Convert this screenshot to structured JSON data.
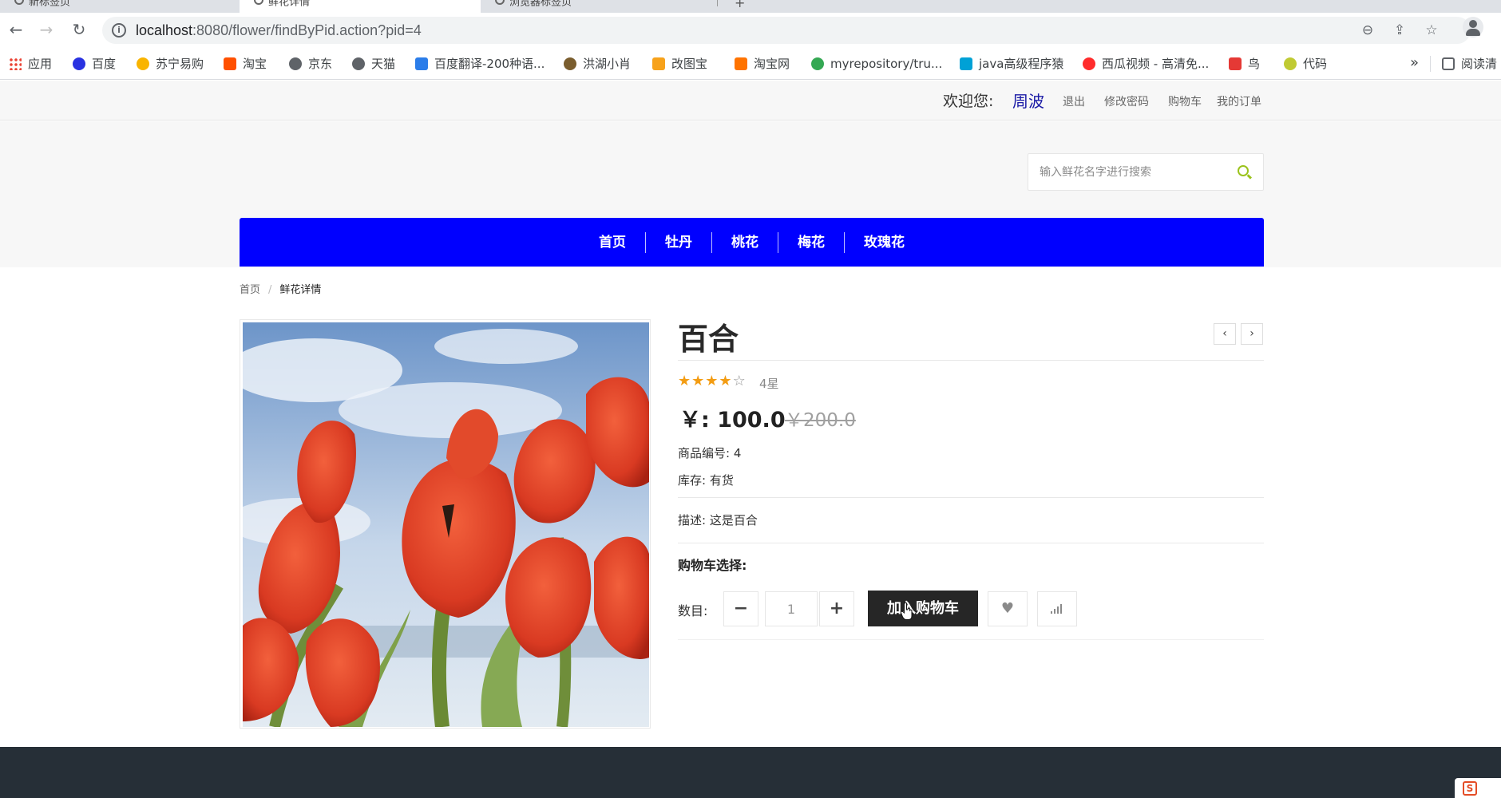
{
  "browser": {
    "tabs": [
      {
        "title": "新标签页"
      },
      {
        "title": "鲜花详情"
      },
      {
        "title": "浏览器标签页"
      }
    ],
    "url_host": "localhost",
    "url_rest": ":8080/flower/findByPid.action?pid=4",
    "bookmarks": [
      {
        "label": "应用",
        "icon": "apps-icon",
        "color": "#ea4335"
      },
      {
        "label": "百度",
        "icon": "baidu-icon",
        "color": "#2932e1"
      },
      {
        "label": "苏宁易购",
        "icon": "suning-icon",
        "color": "#f9b400"
      },
      {
        "label": "淘宝",
        "icon": "taobao-icon",
        "color": "#ff5000"
      },
      {
        "label": "京东",
        "icon": "globe-icon",
        "color": "#5f6368"
      },
      {
        "label": "天猫",
        "icon": "globe-icon",
        "color": "#5f6368"
      },
      {
        "label": "百度翻译-200种语...",
        "icon": "translate-icon",
        "color": "#2b7de9"
      },
      {
        "label": "洪湖小肖",
        "icon": "bird-icon",
        "color": "#7a5d2e"
      },
      {
        "label": "改图宝",
        "icon": "gaitubao-icon",
        "color": "#f7a21b"
      },
      {
        "label": "淘宝网",
        "icon": "taobao-icon",
        "color": "#ff7300"
      },
      {
        "label": "myrepository/tru...",
        "icon": "chrome-icon",
        "color": "#34a853"
      },
      {
        "label": "java高级程序猿",
        "icon": "bilibili-icon",
        "color": "#00a1d6"
      },
      {
        "label": "西瓜视频 - 高清免...",
        "icon": "xigua-icon",
        "color": "#ff2c2c"
      },
      {
        "label": "鸟",
        "icon": "bird-icon",
        "color": "#e53935"
      },
      {
        "label": "代码",
        "icon": "code-icon",
        "color": "#c0ca33"
      }
    ],
    "more_label": "»",
    "reading_list": "阅读清"
  },
  "topbar": {
    "welcome": "欢迎您:",
    "username": "周波",
    "links": [
      "退出",
      "修改密码",
      "购物车",
      "我的订单"
    ]
  },
  "search": {
    "placeholder": "输入鲜花名字进行搜索"
  },
  "nav": {
    "items": [
      "首页",
      "牡丹",
      "桃花",
      "梅花",
      "玫瑰花"
    ],
    "bg_color": "#0000ff"
  },
  "breadcrumb": {
    "home": "首页",
    "current": "鲜花详情"
  },
  "product": {
    "name": "百合",
    "rating": 4,
    "rating_max": 5,
    "rating_text": "4星",
    "price": "￥: 100.0",
    "old_price": "￥200.0",
    "code_label": "商品编号: 4",
    "stock_label": "库存: 有货",
    "description": "描述:  这是百合",
    "cart_title": "购物车选择:",
    "qty_label": "数目:",
    "qty_value": "1",
    "minus": "−",
    "plus": "+",
    "add_to_cart": "加入购物车",
    "prev": "‹",
    "next": "›"
  },
  "colors": {
    "accent_nav": "#0000ff",
    "star": "#f39c12",
    "footer": "#262f37",
    "search_icon": "#9bc31c"
  }
}
